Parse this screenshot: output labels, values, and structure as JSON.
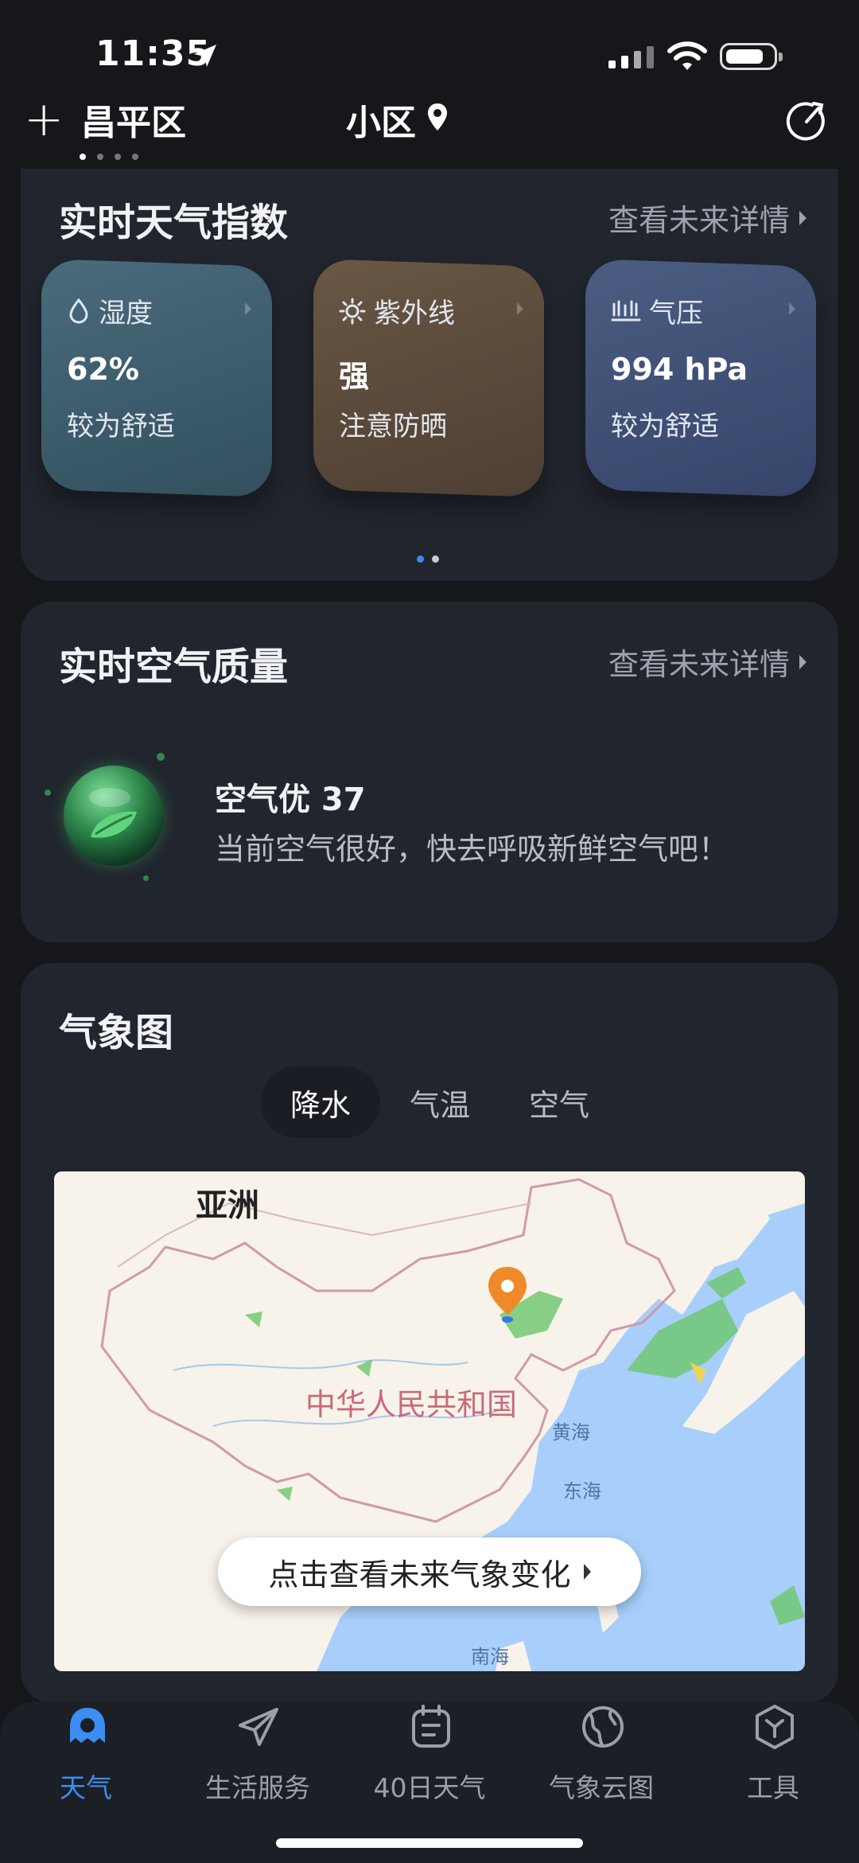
{
  "status_bar": {
    "time": "11:35"
  },
  "header": {
    "add_label": "+",
    "district": "昌平区",
    "area": "小区"
  },
  "index_card": {
    "title": "实时天气指数",
    "more": "查看未来详情",
    "tiles": [
      {
        "name": "湿度",
        "value": "62%",
        "desc": "较为舒适",
        "icon": "droplet-icon",
        "color": "#3b5766"
      },
      {
        "name": "紫外线",
        "value": "强",
        "desc": "注意防晒",
        "icon": "sun-icon",
        "color": "#5a4a3a"
      },
      {
        "name": "气压",
        "value": "994 hPa",
        "desc": "较为舒适",
        "icon": "pressure-icon",
        "color": "#3d4c6a"
      }
    ]
  },
  "air_card": {
    "title": "实时空气质量",
    "more": "查看未来详情",
    "quality": "空气优 37",
    "desc": "当前空气很好，快去呼吸新鲜空气吧！"
  },
  "map_card": {
    "title": "气象图",
    "tabs": [
      "降水",
      "气温",
      "空气"
    ],
    "active_tab": "降水",
    "labels": {
      "continent": "亚洲",
      "country": "中华人民共和国",
      "sea1": "黄海",
      "sea2": "东海",
      "sea3": "南海"
    },
    "cta": "点击查看未来气象变化"
  },
  "bottom_nav": [
    {
      "label": "天气",
      "icon": "weather-ghost-icon",
      "active": true
    },
    {
      "label": "生活服务",
      "icon": "paper-plane-icon",
      "active": false
    },
    {
      "label": "40日天气",
      "icon": "calendar-icon",
      "active": false
    },
    {
      "label": "气象云图",
      "icon": "globe-icon",
      "active": false
    },
    {
      "label": "工具",
      "icon": "toolbox-icon",
      "active": false
    }
  ],
  "colors": {
    "accent": "#3b8ef3",
    "background": "#15171b",
    "card": "#21252d"
  }
}
